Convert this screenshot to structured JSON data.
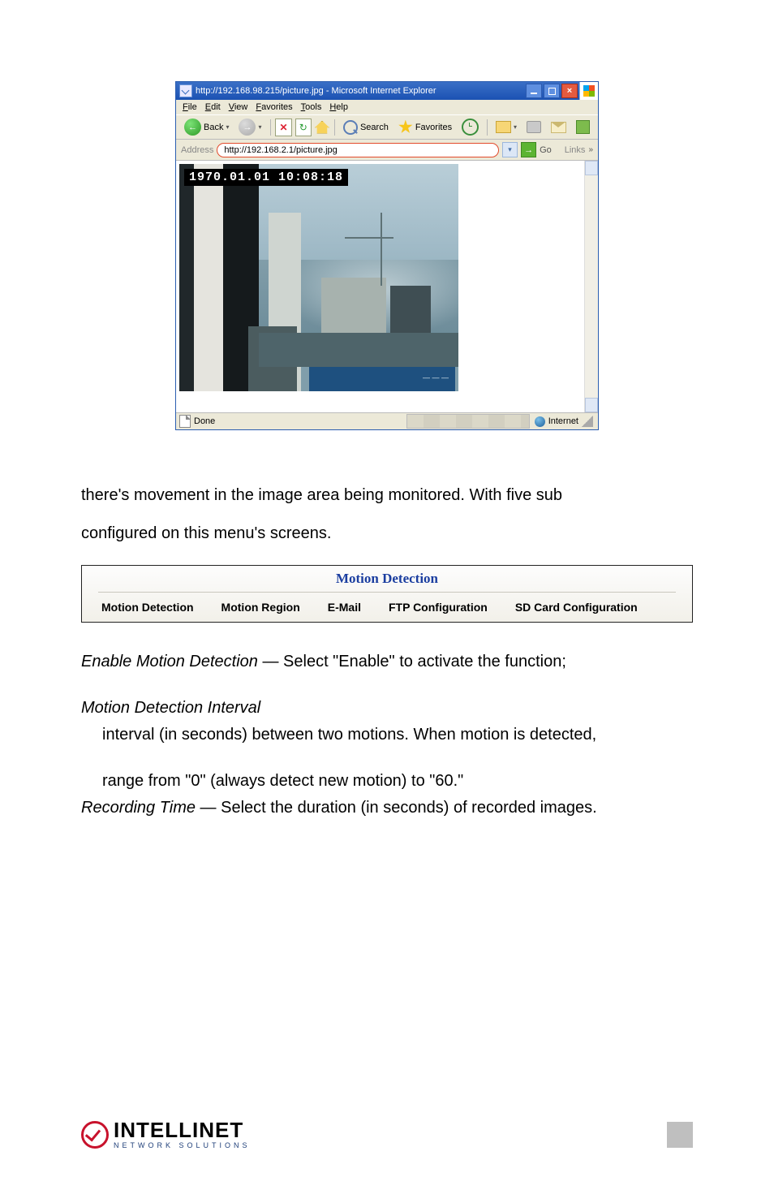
{
  "ie": {
    "title": "http://192.168.98.215/picture.jpg - Microsoft Internet Explorer",
    "menus": [
      "File",
      "Edit",
      "View",
      "Favorites",
      "Tools",
      "Help"
    ],
    "back_label": "Back",
    "search_label": "Search",
    "favorites_label": "Favorites",
    "address_label": "Address",
    "address_value": "http://192.168.2.1/picture.jpg",
    "go_label": "Go",
    "links_label": "Links",
    "timestamp": "1970.01.01 10:08:18",
    "status_done": "Done",
    "status_zone": "Internet"
  },
  "text1": "there's movement in the image area being monitored. With five sub",
  "text2": "configured on this menu's screens.",
  "panel": {
    "heading": "Motion Detection",
    "tabs": [
      "Motion Detection",
      "Motion Region",
      "E-Mail",
      "FTP Configuration",
      "SD Card Configuration"
    ]
  },
  "t3a": "Enable Motion Detection",
  "t3b": " — Select \"Enable\" to activate the function;",
  "t4": "Motion Detection Interval",
  "t5": "interval (in seconds) between two motions. When motion is detected,",
  "t6": "range from \"0\" (always detect new motion) to \"60.\"",
  "t7a": "Recording Time",
  "t7b": " — Select the duration (in seconds) of recorded images.",
  "logo": {
    "word": "INTELLINET",
    "sub": "NETWORK SOLUTIONS"
  }
}
